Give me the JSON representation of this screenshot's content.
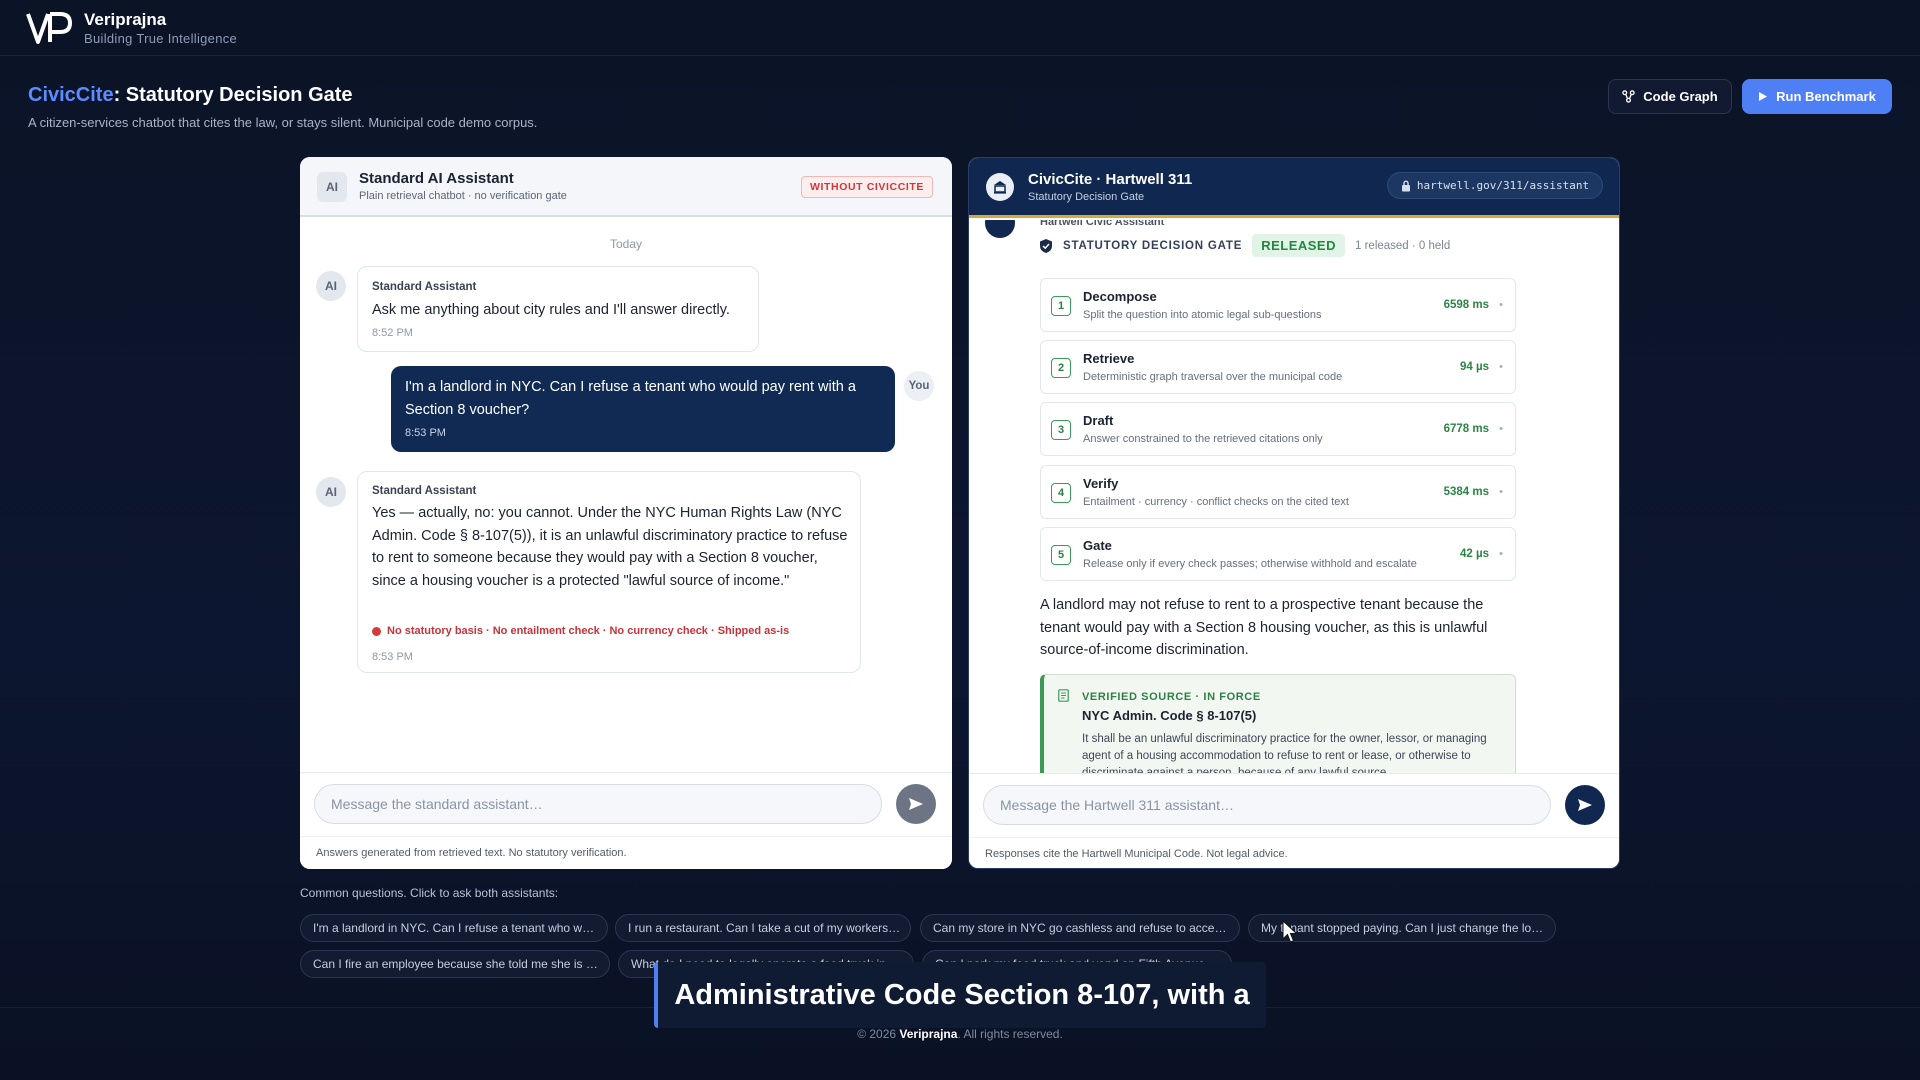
{
  "brand": {
    "name": "Veriprajna",
    "tagline": "Building True Intelligence",
    "logo_mark": "VP"
  },
  "page": {
    "title_accent": "CivicCite",
    "title_rest": ": Statutory Decision Gate",
    "subtitle": "A citizen-services chatbot that cites the law, or stays silent. Municipal code demo corpus."
  },
  "actions": {
    "code_graph": "Code Graph",
    "run_benchmark": "Run Benchmark"
  },
  "left": {
    "avatar": "AI",
    "title": "Standard AI Assistant",
    "subtitle": "Plain retrieval chatbot · no verification gate",
    "badge": "WITHOUT CIVICCITE",
    "today": "Today",
    "messages": [
      {
        "who": "Standard Assistant",
        "text": "Ask me anything about city rules and I'll answer directly.",
        "time": "8:52 PM"
      },
      {
        "who": "You",
        "text": "I'm a landlord in NYC. Can I refuse a tenant who would pay rent with a Section 8 voucher?",
        "time": "8:53 PM"
      },
      {
        "who": "Standard Assistant",
        "text": "Yes — actually, no: you cannot. Under the NYC Human Rights Law (NYC Admin. Code § 8-107(5)), it is an unlawful discriminatory practice to refuse to rent to someone because they would pay with a Section 8 voucher, since a housing voucher is a protected \"lawful source of income.\"",
        "warning": "No statutory basis · No entailment check · No currency check · Shipped as-is",
        "time": "8:53 PM"
      }
    ],
    "input_placeholder": "Message the standard assistant…",
    "footnote": "Answers generated from retrieved text. No statutory verification."
  },
  "right": {
    "title": "CivicCite · Hartwell 311",
    "subtitle": "Statutory Decision Gate",
    "url": "hartwell.gov/311/assistant",
    "sender": "Hartwell Civic Assistant",
    "gate_label": "STATUTORY DECISION GATE",
    "gate_status": "RELEASED",
    "gate_counts": "1 released · 0 held",
    "steps": [
      {
        "num": "1",
        "name": "Decompose",
        "desc": "Split the question into atomic legal sub-questions",
        "ms": "6598 ms"
      },
      {
        "num": "2",
        "name": "Retrieve",
        "desc": "Deterministic graph traversal over the municipal code",
        "ms": "94 µs"
      },
      {
        "num": "3",
        "name": "Draft",
        "desc": "Answer constrained to the retrieved citations only",
        "ms": "6778 ms"
      },
      {
        "num": "4",
        "name": "Verify",
        "desc": "Entailment · currency · conflict checks on the cited text",
        "ms": "5384 ms"
      },
      {
        "num": "5",
        "name": "Gate",
        "desc": "Release only if every check passes; otherwise withhold and escalate",
        "ms": "42 µs"
      }
    ],
    "answer": "A landlord may not refuse to rent to a prospective tenant because the tenant would pay with a Section 8 housing voucher, as this is unlawful source-of-income discrimination.",
    "source": {
      "tag": "VERIFIED SOURCE · IN FORCE",
      "title": "NYC Admin. Code § 8-107(5)",
      "text": "It shall be an unlawful discriminatory practice for the owner, lessor, or managing agent of a housing accommodation to refuse to rent or lease, or otherwise to discriminate against a person, because of any lawful source"
    },
    "input_placeholder": "Message the Hartwell 311 assistant…",
    "footnote": "Responses cite the Hartwell Municipal Code. Not legal advice."
  },
  "common": {
    "label": "Common questions. Click to ask both assistants:",
    "chips": [
      "I'm a landlord in NYC. Can I refuse a tenant who w…",
      "I run a restaurant. Can I take a cut of my workers…",
      "Can my store in NYC go cashless and refuse to acce…",
      "My tenant stopped paying. Can I just change the lo…",
      "Can I fire an employee because she told me she is …",
      "What do I need to legally operate a food truck in…",
      "Can I park my food truck and vend on Fifth Avenue…"
    ]
  },
  "caption": "Administrative Code Section 8-107, with a",
  "footer": {
    "prefix": "© 2026 ",
    "brand": "Veriprajna",
    "suffix": ". All rights reserved."
  },
  "colors": {
    "accent": "#5b8cff",
    "run_button": "#4f7ff5",
    "navy": "#10284f",
    "verified_green": "#2d7f46",
    "warning_red": "#d0363b"
  },
  "icons": {
    "code_graph": "graph-icon",
    "run": "play-icon",
    "lock": "lock-icon",
    "shield": "shield-icon",
    "send": "send-icon",
    "document": "document-icon"
  }
}
